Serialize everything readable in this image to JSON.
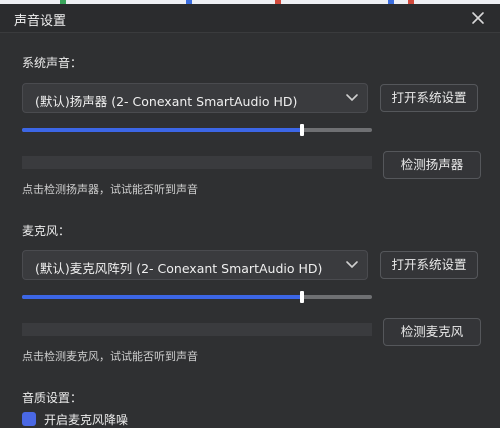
{
  "colors": {
    "accent": "#3c66e6",
    "background": "#2f3032"
  },
  "dialog": {
    "title": "声音设置",
    "close_icon": "close-icon"
  },
  "speaker": {
    "section_label": "系统声音：",
    "device": "(默认)扬声器 (2- Conexant SmartAudio HD)",
    "open_settings_label": "打开系统设置",
    "volume_fraction": 0.8,
    "test_label": "检测扬声器",
    "hint": "点击检测扬声器，试试能否听到声音"
  },
  "microphone": {
    "section_label": "麦克风：",
    "device": "(默认)麦克风阵列 (2- Conexant SmartAudio HD)",
    "open_settings_label": "打开系统设置",
    "volume_fraction": 0.8,
    "test_label": "检测麦克风",
    "hint": "点击检测麦克风，试试能否听到声音"
  },
  "quality": {
    "section_label": "音质设置：",
    "checkbox_label": "开启麦克风降噪",
    "checkbox_checked": true
  }
}
